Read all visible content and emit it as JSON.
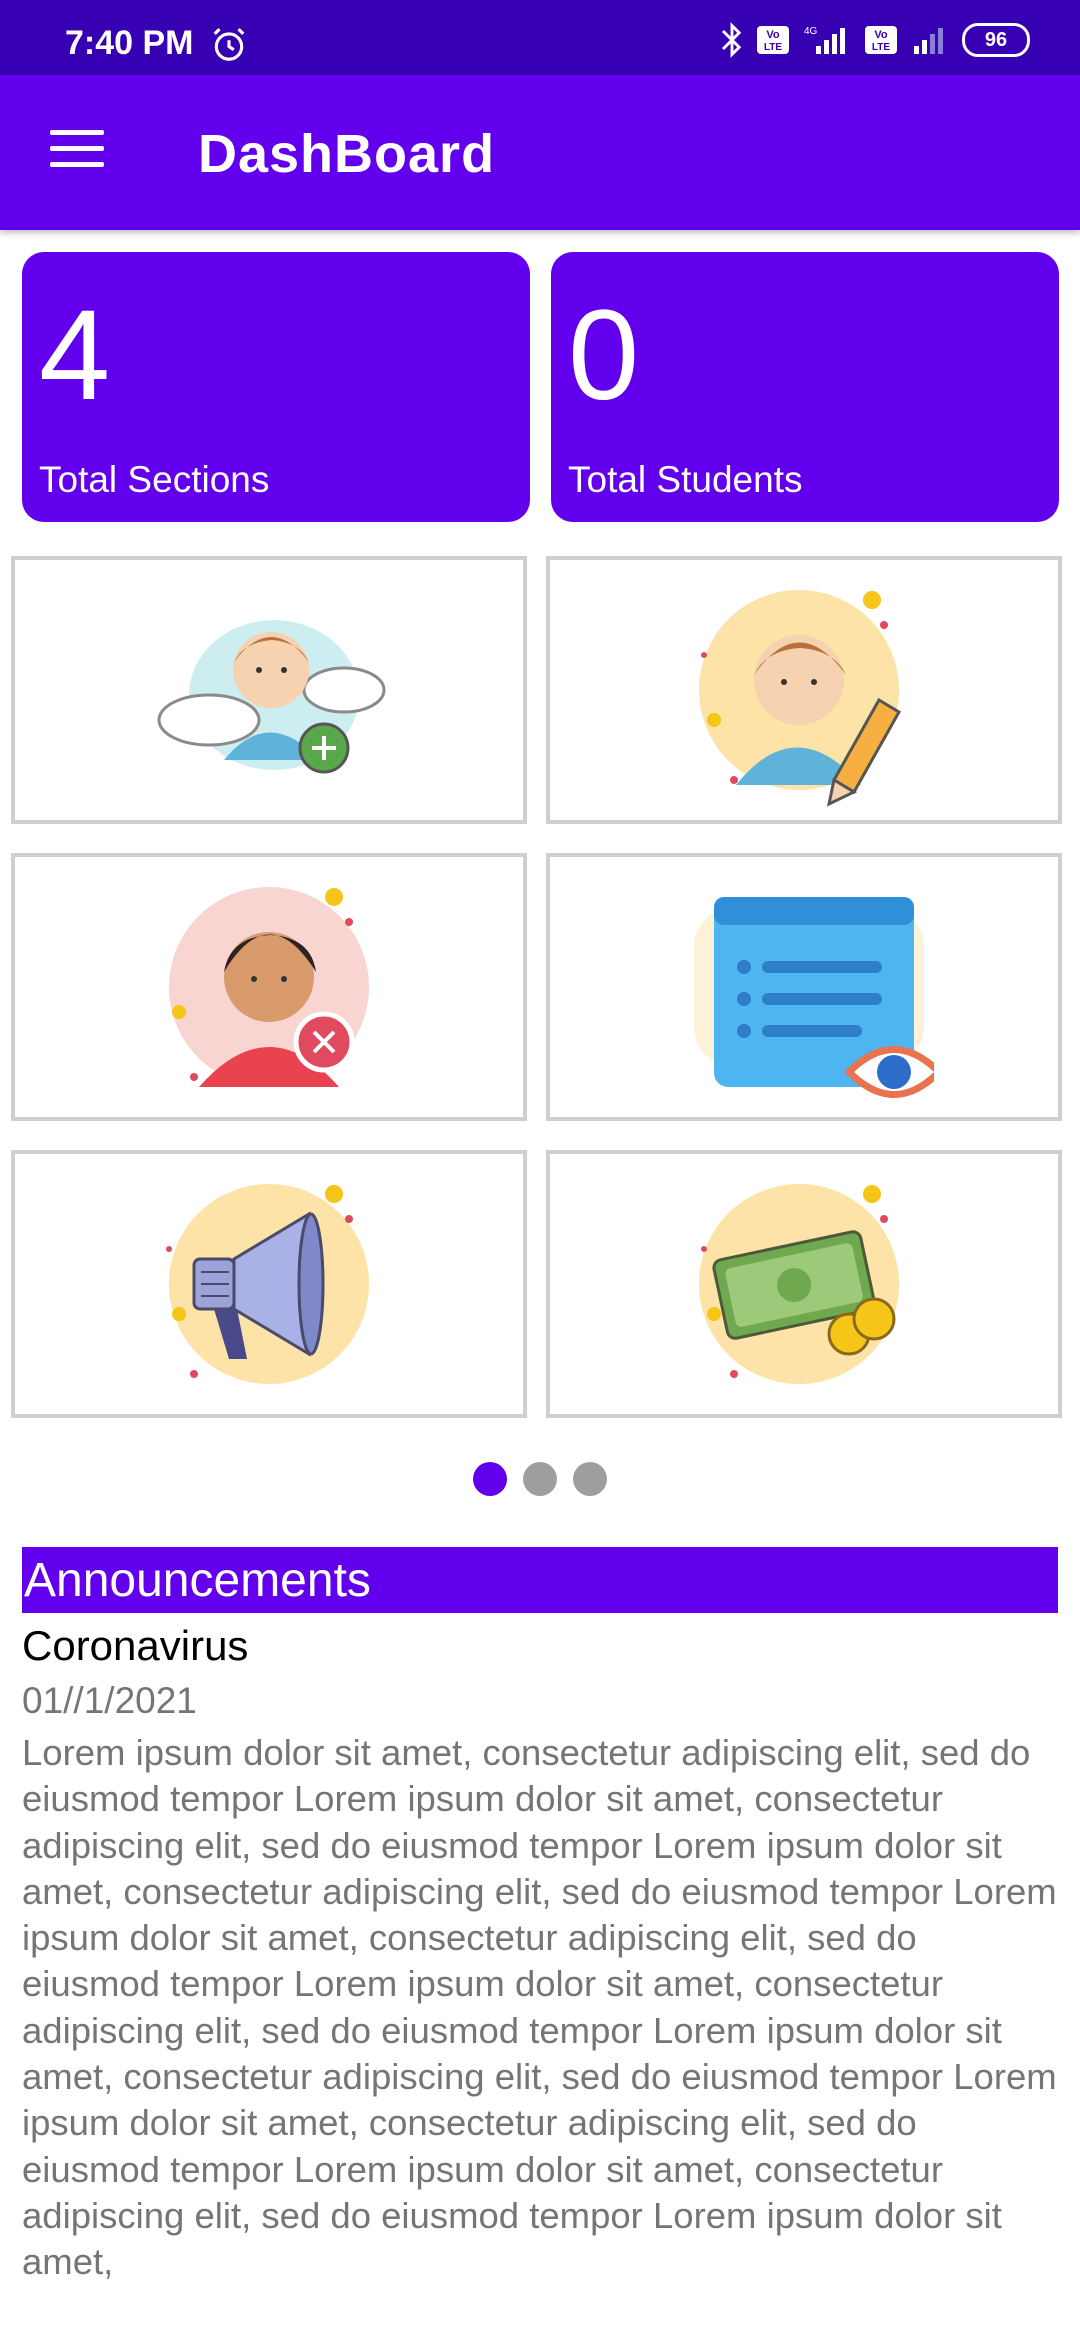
{
  "status_bar": {
    "time": "7:40 PM",
    "battery": "96"
  },
  "app_bar": {
    "title": "DashBoard"
  },
  "stats": [
    {
      "value": "4",
      "label": "Total Sections"
    },
    {
      "value": "0",
      "label": "Total Students"
    }
  ],
  "tiles": [
    {
      "icon": "add-student-icon"
    },
    {
      "icon": "edit-student-icon"
    },
    {
      "icon": "remove-student-icon"
    },
    {
      "icon": "view-details-icon"
    },
    {
      "icon": "announcement-megaphone-icon"
    },
    {
      "icon": "fees-money-icon"
    }
  ],
  "pager": {
    "pages": 3,
    "active": 1
  },
  "announcements": {
    "header": "Announcements",
    "item": {
      "title": "Coronavirus",
      "date": "01//1/2021",
      "body": "Lorem ipsum dolor sit amet, consectetur adipiscing elit, sed do eiusmod tempor Lorem ipsum dolor sit amet, consectetur adipiscing elit, sed do eiusmod tempor Lorem ipsum dolor sit amet, consectetur adipiscing elit, sed do eiusmod tempor Lorem ipsum dolor sit amet, consectetur adipiscing elit, sed do eiusmod tempor Lorem ipsum dolor sit amet, consectetur adipiscing elit, sed do eiusmod tempor Lorem ipsum dolor sit amet, consectetur adipiscing elit, sed do eiusmod tempor Lorem ipsum dolor sit amet, consectetur adipiscing elit, sed do eiusmod tempor Lorem ipsum dolor sit amet, consectetur adipiscing elit, sed do eiusmod tempor Lorem ipsum dolor sit amet,"
    }
  },
  "colors": {
    "primary": "#6200ee",
    "primary_dark": "#3700b3",
    "muted_text": "#757575"
  }
}
